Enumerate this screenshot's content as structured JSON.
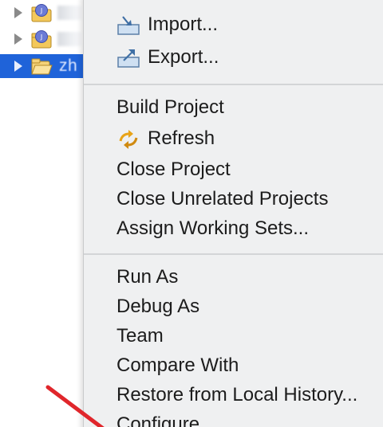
{
  "explorer": {
    "rows": [
      {
        "icon": "java-project-icon"
      },
      {
        "icon": "java-project-icon"
      },
      {
        "icon": "open-folder-project-icon",
        "selected_label": "zh"
      }
    ]
  },
  "context_menu": {
    "import": "Import...",
    "export": "Export...",
    "build_project": "Build Project",
    "refresh": "Refresh",
    "close_project": "Close Project",
    "close_unrelated": "Close Unrelated Projects",
    "assign_working_sets": "Assign Working Sets...",
    "run_as": "Run As",
    "debug_as": "Debug As",
    "team": "Team",
    "compare_with": "Compare With",
    "restore_history": "Restore from Local History...",
    "configure": "Configure"
  },
  "colors": {
    "selection": "#1f63d9",
    "menu_bg": "#eff0f1",
    "annotation": "#e0262b",
    "refresh_icon": "#e8a317"
  }
}
